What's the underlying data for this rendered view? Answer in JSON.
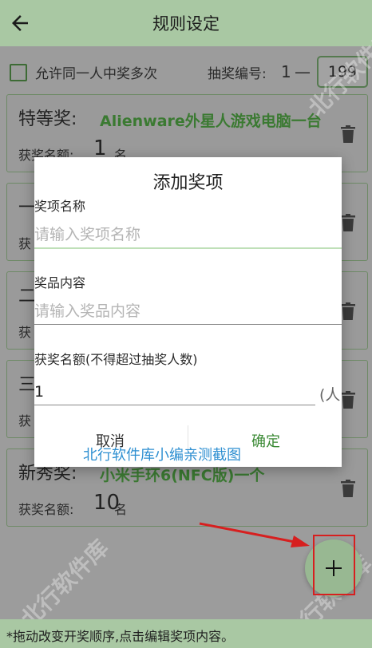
{
  "appbar": {
    "title": "规则设定",
    "back_icon": "arrow-left-icon"
  },
  "options": {
    "allow_multiple_label": "允许同一人中奖多次",
    "allow_multiple_checked": false,
    "number_label": "抽奖编号:",
    "number_start": "1",
    "number_dash": "—",
    "number_end": "199"
  },
  "prizes": [
    {
      "name": "特等奖:",
      "prize": "Alienware外星人游戏电脑一台",
      "quota_label": "获奖名额:",
      "quota": "1",
      "unit": "名"
    },
    {
      "name": "一",
      "prize": "",
      "quota_label": "获",
      "quota": "",
      "unit": ""
    },
    {
      "name": "二",
      "prize": "",
      "quota_label": "获",
      "quota": "",
      "unit": ""
    },
    {
      "name": "三",
      "prize": "",
      "quota_label": "获",
      "quota": "",
      "unit": ""
    },
    {
      "name": "新秀奖:",
      "prize": "小米手环6(NFC版)一个",
      "quota_label": "获奖名额:",
      "quota": "10",
      "unit": "名"
    }
  ],
  "dialog": {
    "title": "添加奖项",
    "name_label": "奖项名称",
    "name_placeholder": "请输入奖项名称",
    "content_label": "奖品内容",
    "content_placeholder": "请输入奖品内容",
    "quota_label": "获奖名额(不得超过抽奖人数)",
    "quota_value": "1",
    "quota_suffix": "(人",
    "cancel_label": "取消",
    "confirm_label": "确定"
  },
  "fab": {
    "icon": "plus-icon"
  },
  "footer": {
    "hint": "*拖动改变开奖顺序,点击编辑奖项内容。"
  },
  "watermark": {
    "caption": "北行软件库小编亲测截图",
    "diagonal": "北行软件库"
  },
  "colors": {
    "appbar": "#a9c8a3",
    "scrim": "#9c9c9c",
    "accent_green": "#3b7a32",
    "confirm_green": "#3b8a35",
    "annotation_red": "#d71f1f",
    "watermark_blue": "#2e8fd1"
  }
}
